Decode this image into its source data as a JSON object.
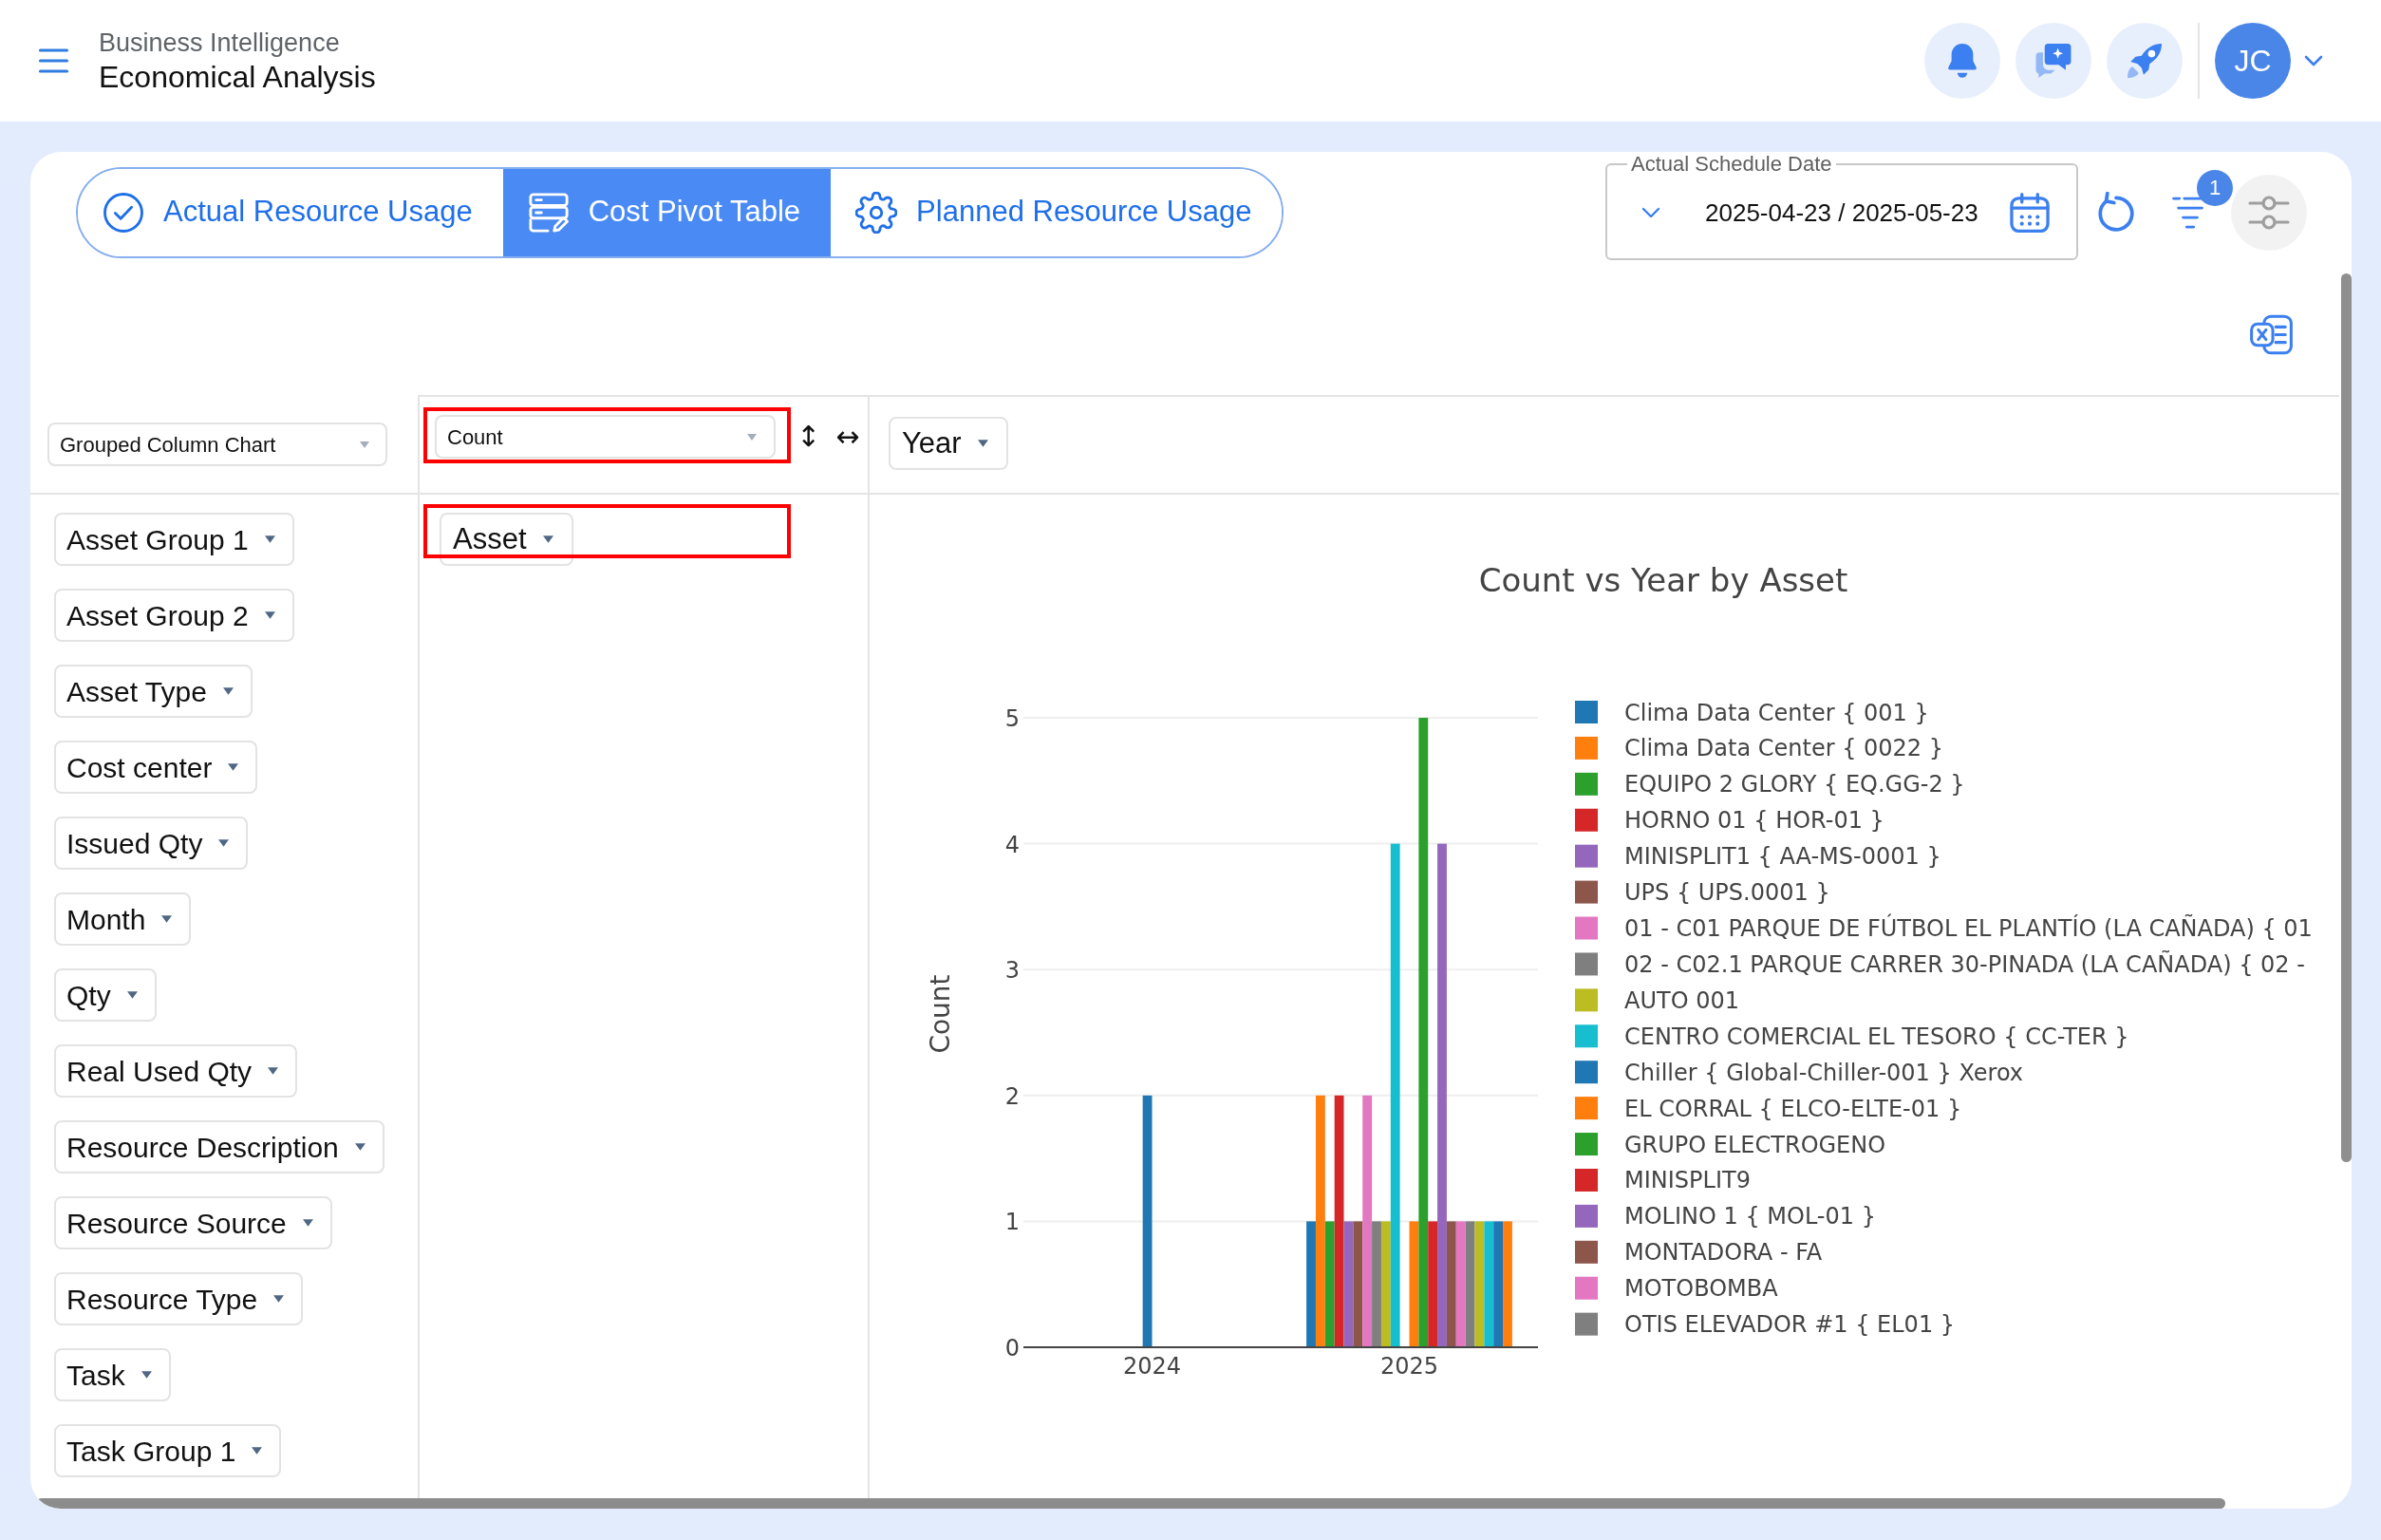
{
  "header": {
    "section": "Business Intelligence",
    "title": "Economical Analysis",
    "avatar": "JC"
  },
  "tabs": [
    {
      "label": "Actual Resource Usage",
      "selected": false
    },
    {
      "label": "Cost Pivot Table",
      "selected": true
    },
    {
      "label": "Planned Resource Usage",
      "selected": false
    }
  ],
  "date_range": {
    "label": "Actual Schedule Date",
    "value": "2025-04-23 / 2025-05-23"
  },
  "filter_badge": "1",
  "pivot": {
    "renderer": "Grouped Column Chart",
    "aggregator": {
      "value": "Count",
      "highlighted": true
    },
    "row_order": "↕",
    "col_order": "↔",
    "column_fields": [
      "Year"
    ],
    "row_area": {
      "fields": [
        "Asset"
      ],
      "highlighted": true
    },
    "unused_fields": [
      "Asset Group 1",
      "Asset Group 2",
      "Asset Type",
      "Cost center",
      "Issued Qty",
      "Month",
      "Qty",
      "Real Used Qty",
      "Resource Description",
      "Resource Source",
      "Resource Type",
      "Task",
      "Task Group 1"
    ],
    "chart_data": {
      "type": "bar",
      "title": "Count vs Year by Asset",
      "ylabel": "Count",
      "categories": [
        "2024",
        "2025"
      ],
      "ylim": [
        0,
        5
      ],
      "yticks": [
        0,
        1,
        2,
        3,
        4,
        5
      ],
      "grid": true,
      "legend": "right",
      "series": [
        {
          "name": "Clima Data Center { 001 }",
          "color": "#1f77b4",
          "values": [
            null,
            1
          ]
        },
        {
          "name": "Clima Data Center { 0022 }",
          "color": "#ff7f0e",
          "values": [
            null,
            2
          ]
        },
        {
          "name": "EQUIPO 2 GLORY { EQ.GG-2 }",
          "color": "#2ca02c",
          "values": [
            null,
            1
          ]
        },
        {
          "name": "HORNO 01 { HOR-01 }",
          "color": "#d62728",
          "values": [
            null,
            2
          ]
        },
        {
          "name": "MINISPLIT1 { AA-MS-0001 }",
          "color": "#9467bd",
          "values": [
            null,
            1
          ]
        },
        {
          "name": "UPS { UPS.0001 }",
          "color": "#8c564b",
          "values": [
            null,
            1
          ]
        },
        {
          "name": "01 - C01 PARQUE DE FÚTBOL EL PLANTÍO (LA CAÑADA) { 01",
          "color": "#e377c2",
          "values": [
            null,
            2
          ]
        },
        {
          "name": "02 - C02.1 PARQUE CARRER 30-PINADA (LA CAÑADA) { 02 -",
          "color": "#7f7f7f",
          "values": [
            null,
            1
          ]
        },
        {
          "name": "AUTO 001",
          "color": "#bcbd22",
          "values": [
            null,
            1
          ]
        },
        {
          "name": "CENTRO COMERCIAL EL TESORO { CC-TER }",
          "color": "#17becf",
          "values": [
            null,
            4
          ]
        },
        {
          "name": "Chiller { Global-Chiller-001 } Xerox",
          "color": "#1f77b4",
          "values": [
            2,
            null
          ]
        },
        {
          "name": "EL CORRAL { ELCO-ELTE-01 }",
          "color": "#ff7f0e",
          "values": [
            null,
            1
          ]
        },
        {
          "name": "GRUPO ELECTROGENO",
          "color": "#2ca02c",
          "values": [
            null,
            5
          ]
        },
        {
          "name": "MINISPLIT9",
          "color": "#d62728",
          "values": [
            null,
            1
          ]
        },
        {
          "name": "MOLINO 1 { MOL-01 }",
          "color": "#9467bd",
          "values": [
            null,
            4
          ]
        },
        {
          "name": "MONTADORA - FA",
          "color": "#8c564b",
          "values": [
            null,
            1
          ]
        },
        {
          "name": "MOTOBOMBA",
          "color": "#e377c2",
          "values": [
            null,
            1
          ]
        },
        {
          "name": "OTIS ELEVADOR #1 { EL01 }",
          "color": "#7f7f7f",
          "values": [
            null,
            1
          ]
        },
        {
          "color": "#bcbd22",
          "values": [
            null,
            1
          ]
        },
        {
          "color": "#17becf",
          "values": [
            null,
            1
          ]
        },
        {
          "color": "#1f77b4",
          "values": [
            null,
            1
          ]
        },
        {
          "color": "#ff7f0e",
          "values": [
            null,
            1
          ]
        }
      ]
    }
  }
}
